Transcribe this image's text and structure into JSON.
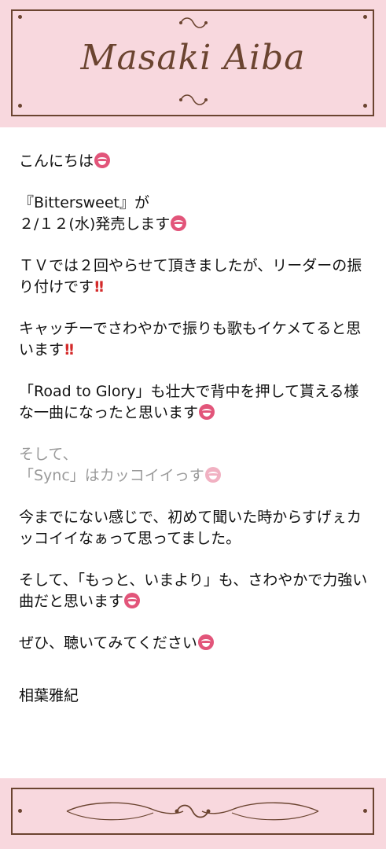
{
  "header": {
    "title": "Masaki Aiba"
  },
  "message": {
    "greeting": "こんにちは",
    "release_line1": "『Bittersweet』が",
    "release_line2": "２/１２(水)発売します",
    "tv_line": "ＴＶでは２回やらせて頂きましたが、リーダーの振り付けです",
    "catchy_line": "キャッチーでさわやかで振りも歌もイケメてると思います",
    "road_line": "「Road to Glory」も壮大で背中を押して貰える様な一曲になったと思います",
    "sync_line1": "そして、",
    "sync_line2": "「Sync」はカッコイイっす",
    "first_listen_line": "今までにない感じで、初めて聞いた時からすげぇカッコイイなぁって思ってました。",
    "motto_line": "そして、「もっと、いまより」も、さわやかで力強い曲だと思います",
    "please_line": "ぜひ、聴いてみてください",
    "signature": "相葉雅紀"
  },
  "icons": {
    "smile": "grinning-face-icon",
    "exclamation": "double-exclamation-icon"
  },
  "colors": {
    "banner_bg": "#f8d8de",
    "ornament": "#6b4430",
    "emoji": "#e2557a",
    "exclamation": "#d42a2a"
  }
}
